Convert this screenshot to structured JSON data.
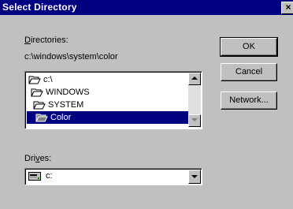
{
  "window": {
    "title": "Select Directory",
    "close_glyph": "×"
  },
  "directories": {
    "label_access": "D",
    "label_rest": "irectories:",
    "current_path": "c:\\windows\\system\\color",
    "items": [
      {
        "label": "c:\\",
        "icon": "open-folder-icon"
      },
      {
        "label": "WINDOWS",
        "icon": "open-folder-icon"
      },
      {
        "label": "SYSTEM",
        "icon": "open-folder-icon"
      },
      {
        "label": "Color",
        "icon": "open-folder-icon",
        "selected": true
      }
    ]
  },
  "drives": {
    "label_pre": "Dri",
    "label_access": "v",
    "label_post": "es:",
    "selected": "c:",
    "icon": "hard-drive-icon"
  },
  "buttons": {
    "ok": "OK",
    "cancel": "Cancel",
    "network": "Network..."
  },
  "colors": {
    "title_bar": "#000080",
    "selection": "#000080",
    "face": "#c0c0c0"
  }
}
